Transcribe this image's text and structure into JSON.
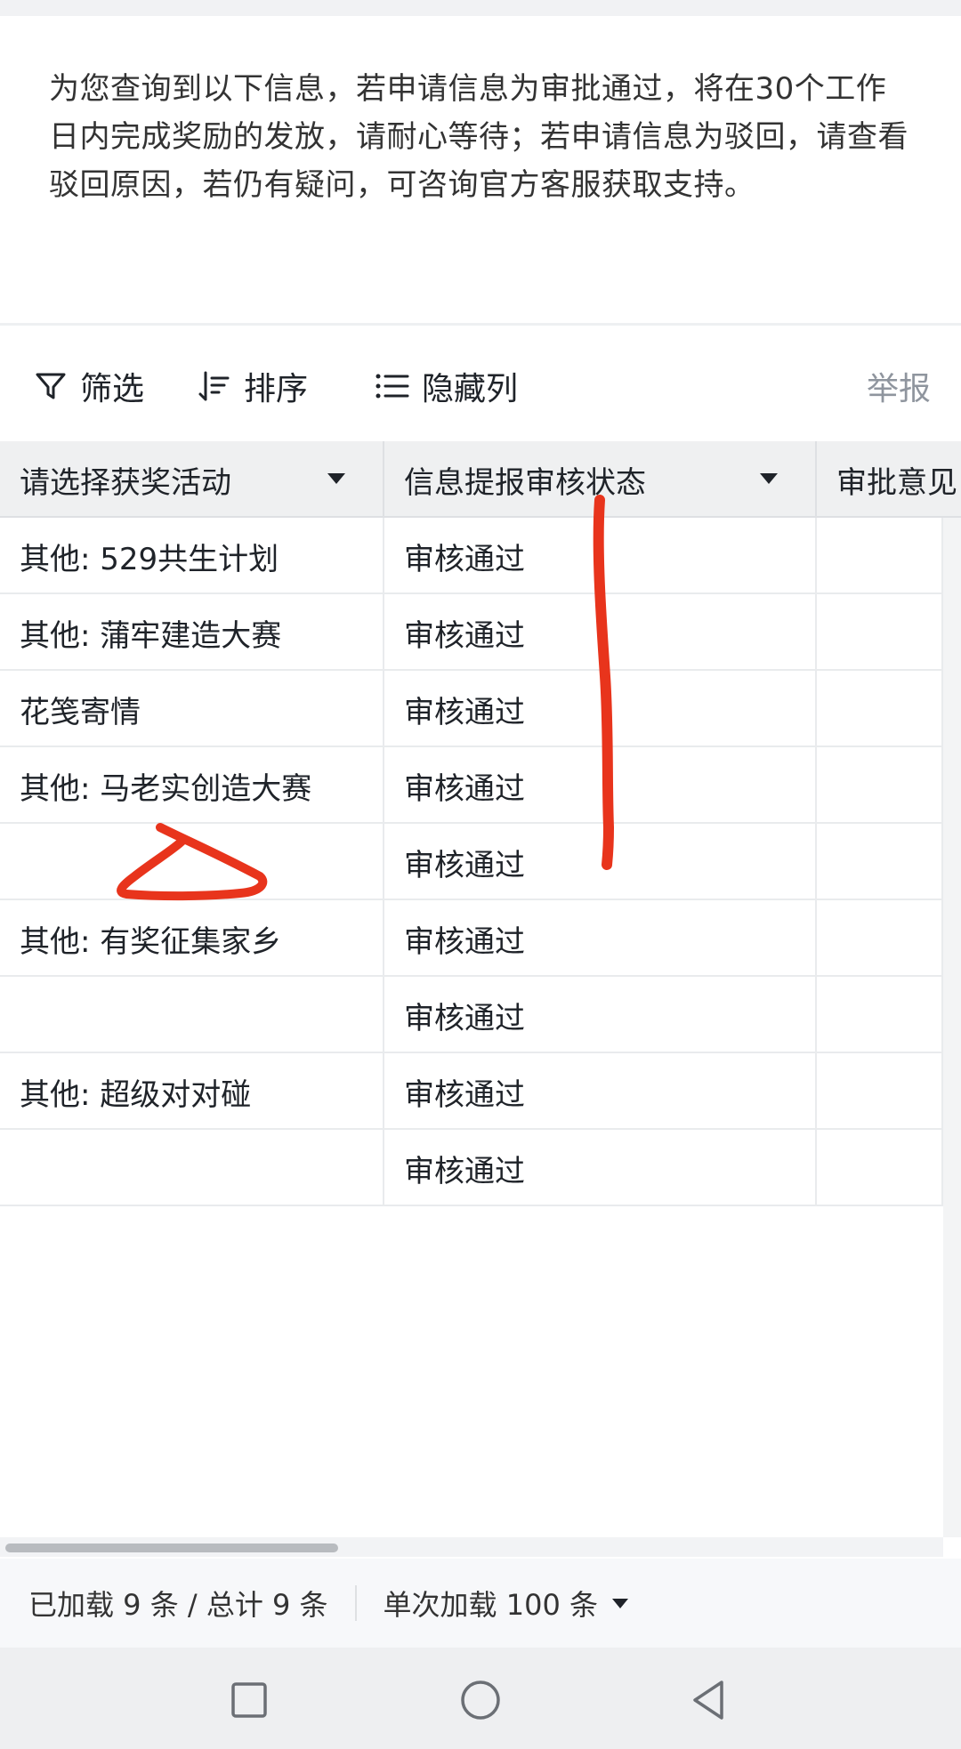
{
  "notice": {
    "text": "为您查询到以下信息，若申请信息为审批通过，将在30个工作日内完成奖励的发放，请耐心等待；若申请信息为驳回，请查看驳回原因，若仍有疑问，可咨询官方客服获取支持。"
  },
  "toolbar": {
    "filter_label": "筛选",
    "sort_label": "排序",
    "hide_columns_label": "隐藏列",
    "report_label": "举报"
  },
  "table": {
    "headers": [
      "请选择获奖活动",
      "信息提报审核状态",
      "审批意见"
    ],
    "rows": [
      {
        "activity": "其他: 529共生计划",
        "status": "审核通过",
        "opinion": ""
      },
      {
        "activity": "其他: 蒲牢建造大赛",
        "status": "审核通过",
        "opinion": ""
      },
      {
        "activity": "花笺寄情",
        "status": "审核通过",
        "opinion": ""
      },
      {
        "activity": "其他: 马老实创造大赛",
        "status": "审核通过",
        "opinion": ""
      },
      {
        "activity": "",
        "status": "审核通过",
        "opinion": ""
      },
      {
        "activity": "其他: 有奖征集家乡",
        "status": "审核通过",
        "opinion": ""
      },
      {
        "activity": "",
        "status": "审核通过",
        "opinion": ""
      },
      {
        "activity": "其他: 超级对对碰",
        "status": "审核通过",
        "opinion": ""
      },
      {
        "activity": "",
        "status": "审核通过",
        "opinion": ""
      }
    ]
  },
  "footer": {
    "loaded_text": "已加载 9 条 / 总计 9 条",
    "page_size_text": "单次加载 100 条"
  },
  "navbar": {
    "icons": [
      "square-icon",
      "circle-icon",
      "triangle-back-icon"
    ]
  },
  "colors": {
    "annotation": "#e8341c",
    "header_bg": "#eff0f1",
    "muted_text": "#8f959e"
  }
}
